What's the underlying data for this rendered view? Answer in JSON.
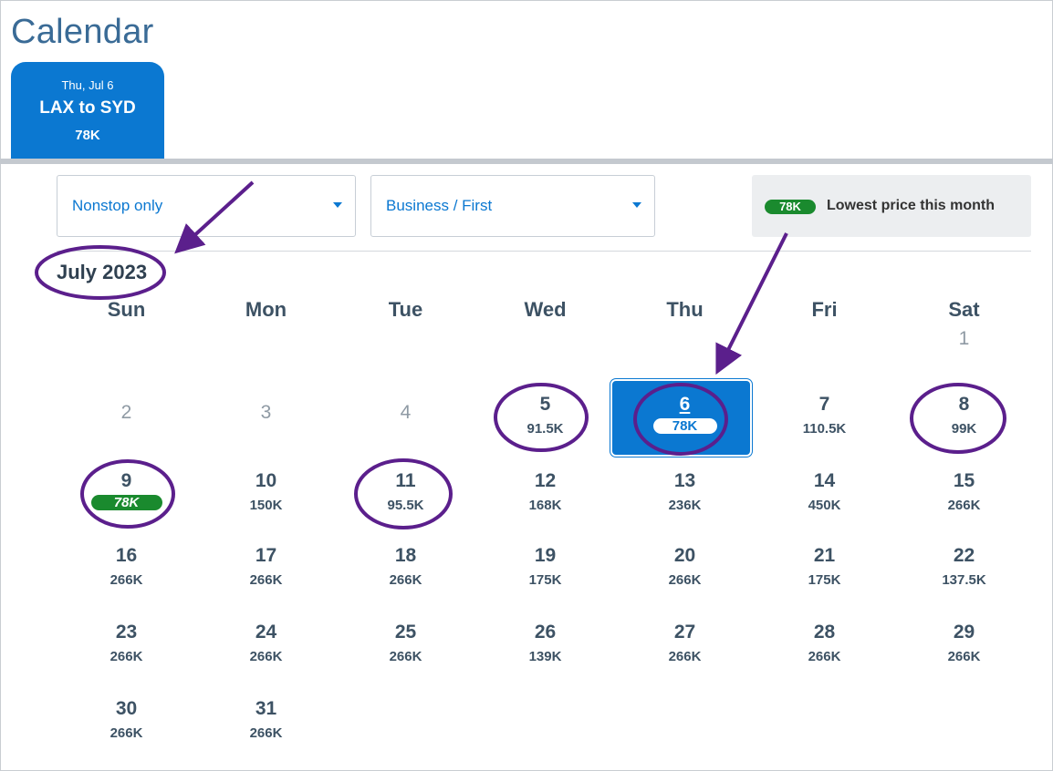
{
  "page": {
    "title": "Calendar"
  },
  "tab": {
    "date": "Thu, Jul 6",
    "route": "LAX to SYD",
    "price": "78K"
  },
  "filters": {
    "stops": "Nonstop only",
    "cabin": "Business / First"
  },
  "legend": {
    "pill": "78K",
    "text": "Lowest price this month"
  },
  "calendar": {
    "month": "July 2023",
    "weekdays": [
      "Sun",
      "Mon",
      "Tue",
      "Wed",
      "Thu",
      "Fri",
      "Sat"
    ],
    "days": [
      {
        "day": "1",
        "price": "",
        "state": "past"
      },
      {
        "day": "2",
        "price": "",
        "state": "past"
      },
      {
        "day": "3",
        "price": "",
        "state": "past"
      },
      {
        "day": "4",
        "price": "",
        "state": "past"
      },
      {
        "day": "5",
        "price": "91.5K",
        "state": "normal"
      },
      {
        "day": "6",
        "price": "78K",
        "state": "selected"
      },
      {
        "day": "7",
        "price": "110.5K",
        "state": "normal"
      },
      {
        "day": "8",
        "price": "99K",
        "state": "normal"
      },
      {
        "day": "9",
        "price": "78K",
        "state": "best"
      },
      {
        "day": "10",
        "price": "150K",
        "state": "normal"
      },
      {
        "day": "11",
        "price": "95.5K",
        "state": "normal"
      },
      {
        "day": "12",
        "price": "168K",
        "state": "normal"
      },
      {
        "day": "13",
        "price": "236K",
        "state": "normal"
      },
      {
        "day": "14",
        "price": "450K",
        "state": "normal"
      },
      {
        "day": "15",
        "price": "266K",
        "state": "normal"
      },
      {
        "day": "16",
        "price": "266K",
        "state": "normal"
      },
      {
        "day": "17",
        "price": "266K",
        "state": "normal"
      },
      {
        "day": "18",
        "price": "266K",
        "state": "normal"
      },
      {
        "day": "19",
        "price": "175K",
        "state": "normal"
      },
      {
        "day": "20",
        "price": "266K",
        "state": "normal"
      },
      {
        "day": "21",
        "price": "175K",
        "state": "normal"
      },
      {
        "day": "22",
        "price": "137.5K",
        "state": "normal"
      },
      {
        "day": "23",
        "price": "266K",
        "state": "normal"
      },
      {
        "day": "24",
        "price": "266K",
        "state": "normal"
      },
      {
        "day": "25",
        "price": "266K",
        "state": "normal"
      },
      {
        "day": "26",
        "price": "139K",
        "state": "normal"
      },
      {
        "day": "27",
        "price": "266K",
        "state": "normal"
      },
      {
        "day": "28",
        "price": "266K",
        "state": "normal"
      },
      {
        "day": "29",
        "price": "266K",
        "state": "normal"
      },
      {
        "day": "30",
        "price": "266K",
        "state": "normal"
      },
      {
        "day": "31",
        "price": "266K",
        "state": "normal"
      }
    ]
  },
  "colors": {
    "accent": "#0b78d1",
    "best_price": "#1a8a2e",
    "annotation": "#5b1f8c"
  }
}
